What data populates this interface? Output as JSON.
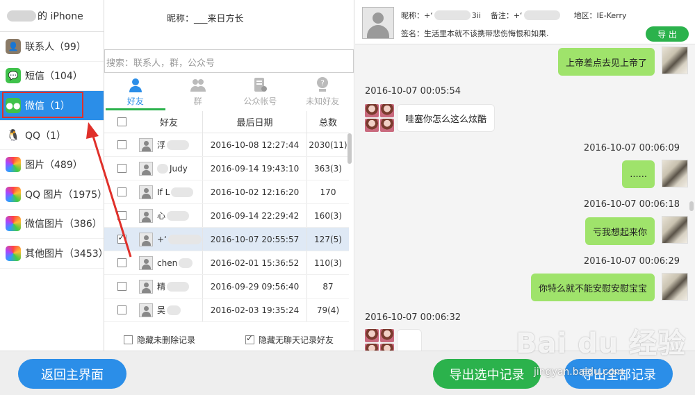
{
  "sidebar": {
    "device_label": "的 iPhone",
    "items": [
      {
        "label": "联系人（99）",
        "icon": "contacts-icon"
      },
      {
        "label": "短信（104）",
        "icon": "sms-icon"
      },
      {
        "label": "微信（1）",
        "icon": "wechat-icon",
        "active": true
      },
      {
        "label": "QQ（1）",
        "icon": "qq-icon"
      },
      {
        "label": "图片（489）",
        "icon": "photos-icon"
      },
      {
        "label": "QQ 图片（1975）",
        "icon": "qq-photos-icon"
      },
      {
        "label": "微信图片（386）",
        "icon": "wechat-photos-icon"
      },
      {
        "label": "其他图片（3453）",
        "icon": "other-photos-icon"
      }
    ]
  },
  "middle": {
    "nickname_label": "昵称：___来日方长",
    "search_placeholder": "搜索：联系人，群，公众号",
    "tabs": [
      {
        "label": "好友",
        "icon": "friend-icon",
        "active": true
      },
      {
        "label": "群",
        "icon": "group-icon"
      },
      {
        "label": "公众帐号",
        "icon": "official-account-icon"
      },
      {
        "label": "未知好友",
        "icon": "unknown-friend-icon"
      }
    ],
    "columns": {
      "name": "好友",
      "date": "最后日期",
      "total": "总数"
    },
    "rows": [
      {
        "name": "浮",
        "date": "2016-10-08 12:27:44",
        "total": "2030(11)",
        "checked": false
      },
      {
        "name": "Judy",
        "date": "2016-09-14 19:43:10",
        "total": "363(3)",
        "checked": false
      },
      {
        "name": "If L",
        "date": "2016-10-02 12:16:20",
        "total": "170",
        "checked": false
      },
      {
        "name": "心",
        "date": "2016-09-14 22:29:42",
        "total": "160(3)",
        "checked": false
      },
      {
        "name": "+‘",
        "date": "2016-10-07 20:55:57",
        "total": "127(5)",
        "checked": true
      },
      {
        "name": "chen",
        "date": "2016-02-01 15:36:52",
        "total": "110(3)",
        "checked": false
      },
      {
        "name": "精",
        "date": "2016-09-29 09:56:40",
        "total": "87",
        "checked": false
      },
      {
        "name": "吴",
        "date": "2016-02-03 19:35:24",
        "total": "79(4)",
        "checked": false
      }
    ],
    "opt_hide_deleted": "隐藏未删除记录",
    "opt_hide_no_chat": "隐藏无聊天记录好友"
  },
  "chat": {
    "nick_label": "昵称：+‘",
    "nick_suffix": "3ii",
    "remark_label": "备注：+‘",
    "region_label": "地区：IE-Kerry",
    "signature": "签名：生活里本就不该携带悲伤悔恨和如果.",
    "export_label": "导 出",
    "messages": [
      {
        "from": "me",
        "text": "上帝差点去见上帝了"
      },
      {
        "ts": "2016-10-07 00:05:54"
      },
      {
        "from": "them",
        "text": "哇塞你怎么这么炫酷"
      },
      {
        "ts": "2016-10-07 00:06:09"
      },
      {
        "from": "me",
        "text": "......"
      },
      {
        "ts": "2016-10-07 00:06:18"
      },
      {
        "from": "me",
        "text": "亏我想起来你"
      },
      {
        "ts": "2016-10-07 00:06:29"
      },
      {
        "from": "me",
        "text": "你特么就不能安慰安慰宝宝"
      },
      {
        "ts": "2016-10-07 00:06:32"
      },
      {
        "from": "them",
        "text": ""
      }
    ]
  },
  "bottom": {
    "back_label": "返回主界面",
    "export_selected_label": "导出选中记录",
    "export_all_label": "导出全部记录"
  },
  "watermark": {
    "main": "Bai du 经验",
    "sub": "jingyan.baidu.com"
  },
  "colors": {
    "accent_blue": "#2b8ee8",
    "accent_green": "#2bb24c",
    "bubble_green": "#9fe36b",
    "highlight_red": "#e0302a"
  }
}
